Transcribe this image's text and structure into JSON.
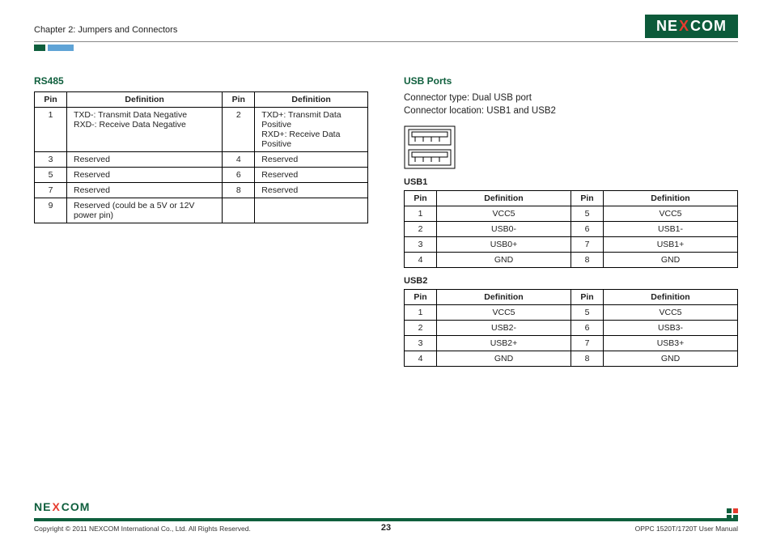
{
  "header": {
    "chapter": "Chapter 2: Jumpers and Connectors",
    "logo_pre": "NE",
    "logo_x": "X",
    "logo_post": "COM"
  },
  "rs485": {
    "title": "RS485",
    "headers": {
      "pin": "Pin",
      "def": "Definition"
    },
    "rows": [
      {
        "p1": "1",
        "d1": "TXD-: Transmit Data Negative\nRXD-: Receive Data Negative",
        "p2": "2",
        "d2": "TXD+: Transmit Data Positive\nRXD+: Receive Data Positive"
      },
      {
        "p1": "3",
        "d1": "Reserved",
        "p2": "4",
        "d2": "Reserved"
      },
      {
        "p1": "5",
        "d1": "Reserved",
        "p2": "6",
        "d2": "Reserved"
      },
      {
        "p1": "7",
        "d1": "Reserved",
        "p2": "8",
        "d2": "Reserved"
      },
      {
        "p1": "9",
        "d1": "Reserved (could be a 5V or 12V power pin)",
        "p2": "",
        "d2": ""
      }
    ]
  },
  "usb": {
    "title": "USB Ports",
    "desc1": "Connector type: Dual USB port",
    "desc2": "Connector location: USB1 and USB2",
    "headers": {
      "pin": "Pin",
      "def": "Definition"
    },
    "usb1_title": "USB1",
    "usb1_rows": [
      {
        "p1": "1",
        "d1": "VCC5",
        "p2": "5",
        "d2": "VCC5"
      },
      {
        "p1": "2",
        "d1": "USB0-",
        "p2": "6",
        "d2": "USB1-"
      },
      {
        "p1": "3",
        "d1": "USB0+",
        "p2": "7",
        "d2": "USB1+"
      },
      {
        "p1": "4",
        "d1": "GND",
        "p2": "8",
        "d2": "GND"
      }
    ],
    "usb2_title": "USB2",
    "usb2_rows": [
      {
        "p1": "1",
        "d1": "VCC5",
        "p2": "5",
        "d2": "VCC5"
      },
      {
        "p1": "2",
        "d1": "USB2-",
        "p2": "6",
        "d2": "USB3-"
      },
      {
        "p1": "3",
        "d1": "USB2+",
        "p2": "7",
        "d2": "USB3+"
      },
      {
        "p1": "4",
        "d1": "GND",
        "p2": "8",
        "d2": "GND"
      }
    ]
  },
  "footer": {
    "copyright": "Copyright © 2011 NEXCOM International Co., Ltd. All Rights Reserved.",
    "page": "23",
    "manual": "OPPC 1520T/1720T User Manual"
  }
}
